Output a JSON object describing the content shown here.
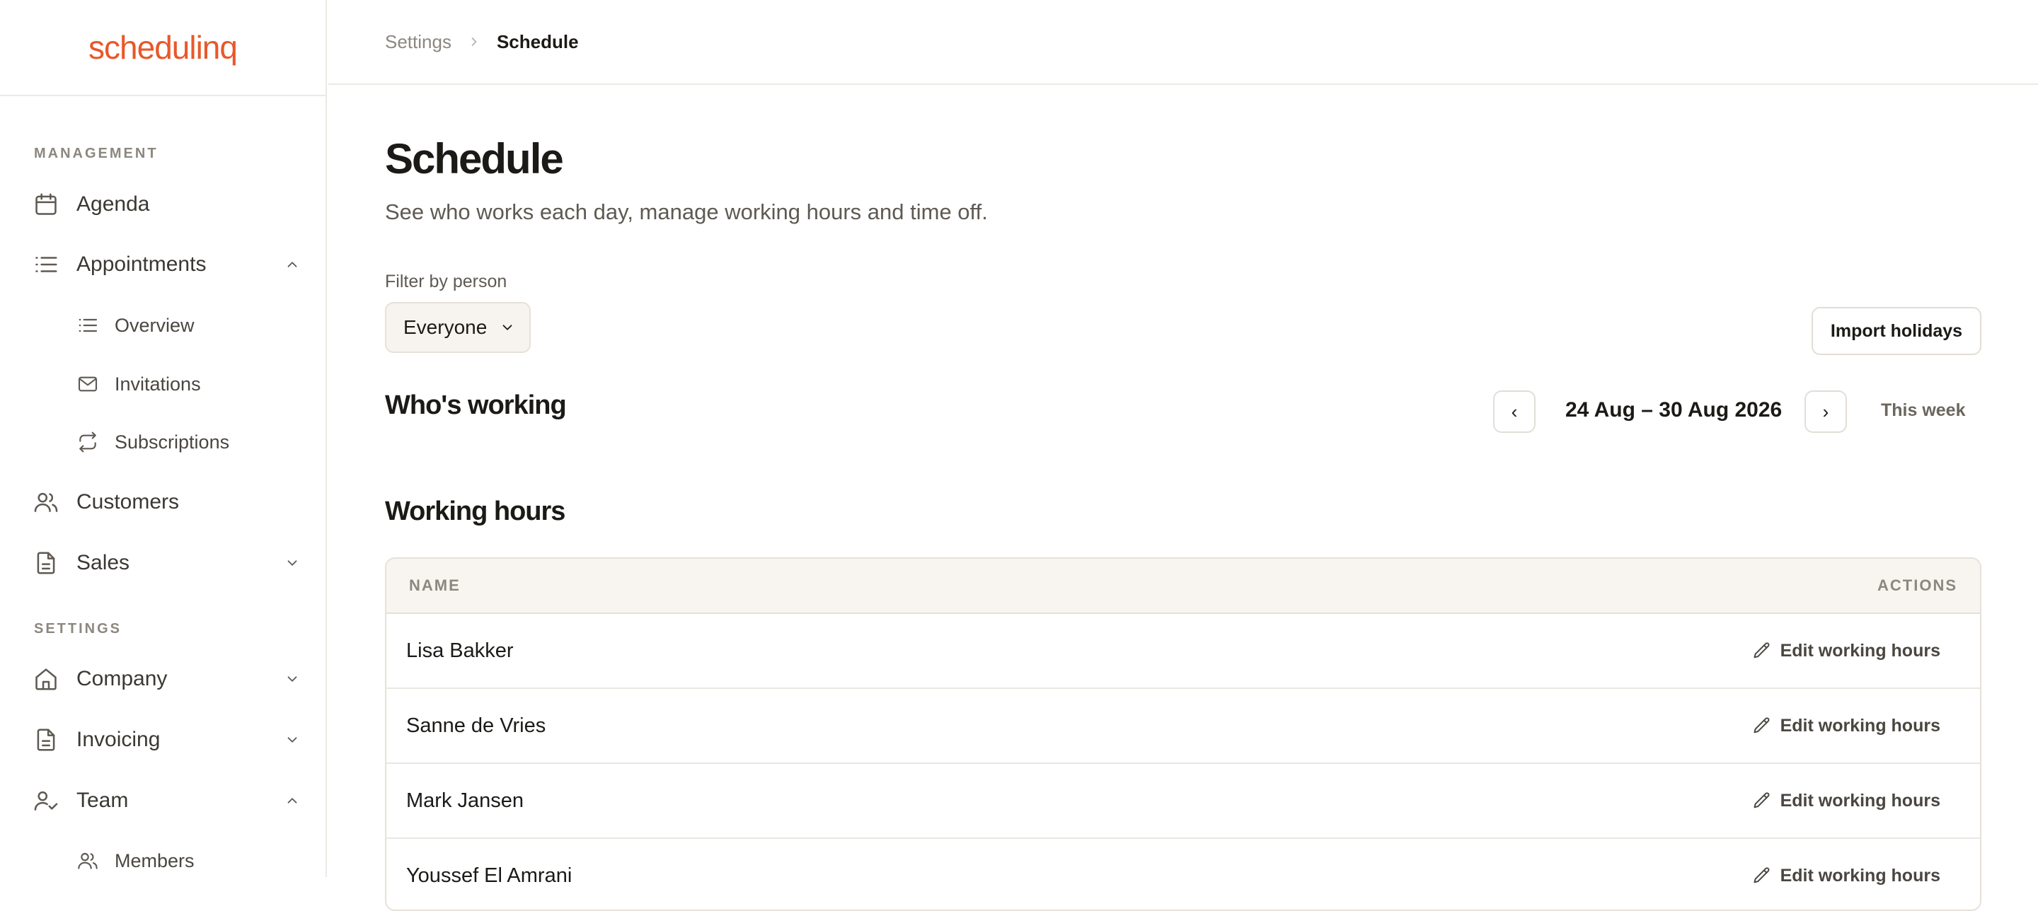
{
  "app": {
    "logo": "schedulinq",
    "brand_color": "#e8582a"
  },
  "sidebar": {
    "sections": [
      {
        "label": "MANAGEMENT"
      },
      {
        "label": "SETTINGS"
      }
    ],
    "items": [
      {
        "label": "Agenda",
        "icon": "calendar-icon"
      },
      {
        "label": "Appointments",
        "icon": "list-icon",
        "expanded": true
      },
      {
        "label": "Overview",
        "icon": "list-icon",
        "sub": true
      },
      {
        "label": "Invitations",
        "icon": "mail-icon",
        "sub": true
      },
      {
        "label": "Subscriptions",
        "icon": "repeat-icon",
        "sub": true
      },
      {
        "label": "Customers",
        "icon": "users-icon"
      },
      {
        "label": "Sales",
        "icon": "document-icon",
        "expanded": false
      },
      {
        "label": "Company",
        "icon": "home-icon",
        "expanded": false
      },
      {
        "label": "Invoicing",
        "icon": "document-icon",
        "expanded": false
      },
      {
        "label": "Team",
        "icon": "user-check-icon",
        "expanded": true
      },
      {
        "label": "Members",
        "icon": "users-icon",
        "sub": true
      }
    ]
  },
  "breadcrumb": {
    "parent": "Settings",
    "current": "Schedule"
  },
  "page": {
    "title": "Schedule",
    "subtitle": "See who works each day, manage working hours and time off."
  },
  "filter": {
    "label": "Filter by person",
    "value": "Everyone"
  },
  "import_button": "Import holidays",
  "whos_working": {
    "title": "Who's working",
    "prev": "‹",
    "next": "›",
    "date_range": "24 Aug – 30 Aug 2026",
    "this_week": "This week"
  },
  "working_hours": {
    "title": "Working hours",
    "columns": [
      "NAME",
      "ACTIONS"
    ],
    "action_label": "Edit working hours",
    "rows": [
      {
        "name": "Lisa Bakker"
      },
      {
        "name": "Sanne de Vries"
      },
      {
        "name": "Mark Jansen"
      },
      {
        "name": "Youssef El Amrani"
      }
    ]
  }
}
